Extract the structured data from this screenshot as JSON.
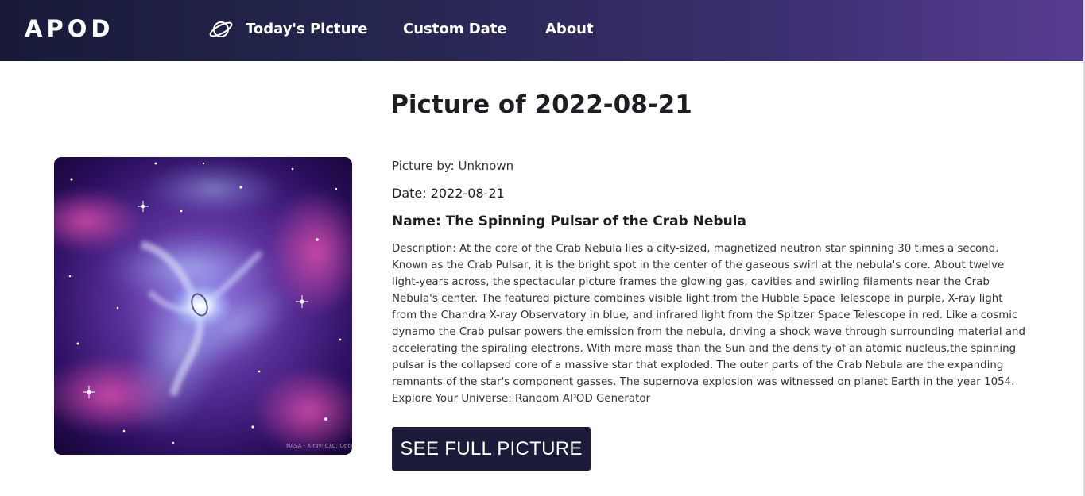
{
  "nav": {
    "brand": "APOD",
    "links": [
      {
        "label": "Today's Picture",
        "icon": "planet-icon"
      },
      {
        "label": "Custom Date"
      },
      {
        "label": "About"
      }
    ]
  },
  "main": {
    "title": "Picture of 2022-08-21",
    "image_alt": "The Spinning Pulsar of the Crab Nebula",
    "image_credit": "NASA - X-ray: CXC; Optic",
    "author": "Picture by: Unknown",
    "date": "Date: 2022-08-21",
    "name": "Name: The Spinning Pulsar of the Crab Nebula",
    "description": "Description: At the core of the Crab Nebula lies a city-sized, magnetized neutron star spinning 30 times a second. Known as the Crab Pulsar, it is the bright spot in the center of the gaseous swirl at the nebula's core. About twelve light-years across, the spectacular picture frames the glowing gas, cavities and swirling filaments near the Crab Nebula's center. The featured picture combines visible light from the Hubble Space Telescope in purple, X-ray light from the Chandra X-ray Observatory in blue, and infrared light from the Spitzer Space Telescope in red. Like a cosmic dynamo the Crab pulsar powers the emission from the nebula, driving a shock wave through surrounding material and accelerating the spiraling electrons. With more mass than the Sun and the density of an atomic nucleus,the spinning pulsar is the collapsed core of a massive star that exploded. The outer parts of the Crab Nebula are the expanding remnants of the star's component gasses. The supernova explosion was witnessed on planet Earth in the year 1054. Explore Your Universe: Random APOD Generator",
    "button_label": "SEE FULL PICTURE"
  },
  "colors": {
    "nav_gradient_start": "#181a38",
    "nav_gradient_end": "#573c92",
    "button_bg": "#1c1c3a",
    "title_text": "#1d1d24"
  }
}
